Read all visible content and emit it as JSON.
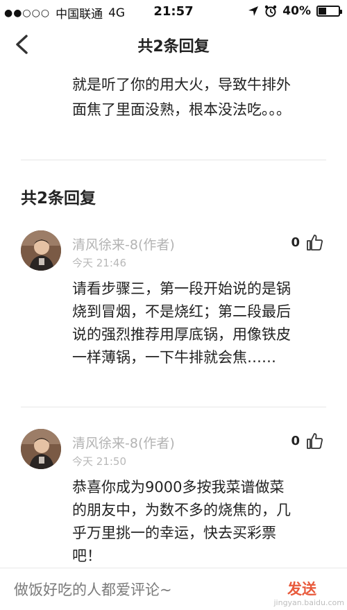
{
  "status_bar": {
    "signal": "●●○○○",
    "carrier": "中国联通",
    "network": "4G",
    "time": "21:57",
    "battery": "40%",
    "battery_level": 0.4
  },
  "nav": {
    "title": "共2条回复"
  },
  "original_comment": {
    "text": "就是听了你的用大火，导致牛排外面焦了里面没熟，根本没法吃。。。"
  },
  "section_title": "共2条回复",
  "replies": [
    {
      "author": "清风徐来-8(作者)",
      "time": "今天 21:46",
      "likes": "0",
      "text": "请看步骤三，第一段开始说的是锅烧到冒烟，不是烧红；第二段最后说的强烈推荐用厚底锅，用像铁皮一样薄锅，一下牛排就会焦……"
    },
    {
      "author": "清风徐来-8(作者)",
      "time": "今天 21:50",
      "likes": "0",
      "text": "恭喜你成为9000多按我菜谱做菜的朋友中，为数不多的烧焦的，几乎万里挑一的幸运，快去买彩票吧！"
    }
  ],
  "bottom_bar": {
    "placeholder": "做饭好吃的人都爱评论~",
    "send_label": "发送"
  },
  "watermark": "jingyan.baidu.com"
}
